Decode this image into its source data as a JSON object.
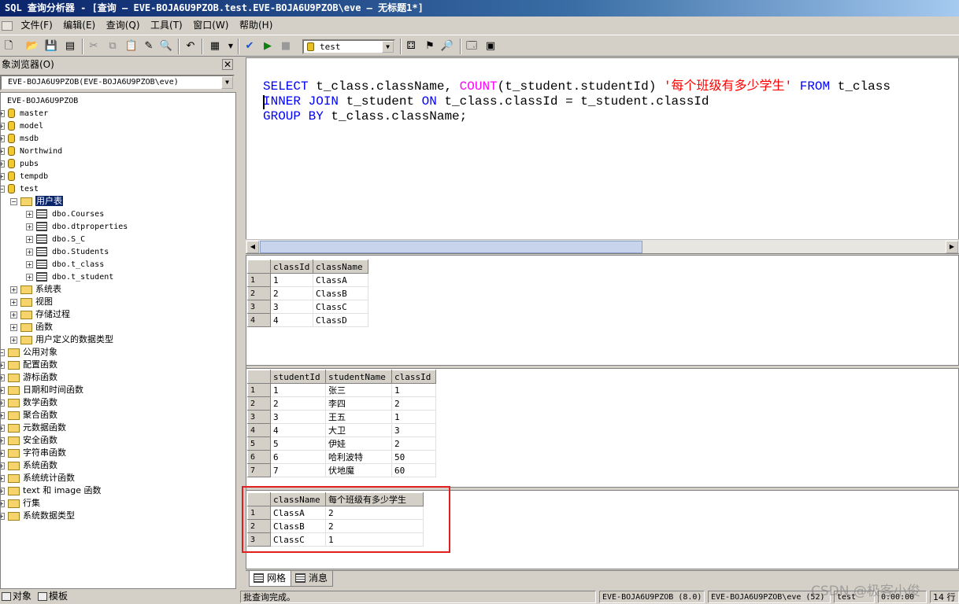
{
  "window": {
    "title": "SQL 查询分析器 - [查询 — EVE-BOJA6U9PZOB.test.EVE-BOJA6U9PZOB\\eve — 无标题1*]"
  },
  "menu": [
    "文件(F)",
    "编辑(E)",
    "查询(Q)",
    "工具(T)",
    "窗口(W)",
    "帮助(H)"
  ],
  "toolbar": {
    "database": "test"
  },
  "object_browser": {
    "title": "象浏览器(O)",
    "server": "EVE-BOJA6U9PZOB(EVE-BOJA6U9PZOB\\eve)",
    "root": "EVE-BOJA6U9PZOB",
    "databases": [
      "master",
      "model",
      "msdb",
      "Northwind",
      "pubs",
      "tempdb",
      "test"
    ],
    "user_tables_label": "用户表",
    "tables": [
      "dbo.Courses",
      "dbo.dtproperties",
      "dbo.S_C",
      "dbo.Students",
      "dbo.t_class",
      "dbo.t_student"
    ],
    "test_folders": [
      "系统表",
      "视图",
      "存储过程",
      "函数",
      "用户定义的数据类型"
    ],
    "common_label": "公用对象",
    "common_items": [
      "配置函数",
      "游标函数",
      "日期和时间函数",
      "数学函数",
      "聚合函数",
      "元数据函数",
      "安全函数",
      "字符串函数",
      "系统函数",
      "系统统计函数",
      "text 和 image 函数",
      "行集",
      "系统数据类型"
    ],
    "tabs": [
      "对象",
      "模板"
    ]
  },
  "editor": {
    "line1": [
      "SELECT",
      " t_class.className, ",
      "COUNT",
      "(t_student.studentId) ",
      "'每个班级有多少学生'",
      " FROM",
      " t_class"
    ],
    "line2": [
      "INNER JOIN",
      " t_student ",
      "ON",
      " t_class.classId = t_student.classId"
    ],
    "line3": [
      "GROUP BY",
      " t_class.className;"
    ]
  },
  "results": {
    "grid1": {
      "columns": [
        "classId",
        "className"
      ],
      "rows": [
        [
          "1",
          "ClassA"
        ],
        [
          "2",
          "ClassB"
        ],
        [
          "3",
          "ClassC"
        ],
        [
          "4",
          "ClassD"
        ]
      ]
    },
    "grid2": {
      "columns": [
        "studentId",
        "studentName",
        "classId"
      ],
      "rows": [
        [
          "1",
          "张三",
          "1"
        ],
        [
          "2",
          "李四",
          "2"
        ],
        [
          "3",
          "王五",
          "1"
        ],
        [
          "4",
          "大卫",
          "3"
        ],
        [
          "5",
          "伊娃",
          "2"
        ],
        [
          "6",
          "哈利波特",
          "50"
        ],
        [
          "7",
          "伏地魔",
          "60"
        ]
      ]
    },
    "grid3": {
      "columns": [
        "className",
        "每个班级有多少学生"
      ],
      "rows": [
        [
          "ClassA",
          "2"
        ],
        [
          "ClassB",
          "2"
        ],
        [
          "ClassC",
          "1"
        ]
      ]
    },
    "tabs": [
      "网格",
      "消息"
    ]
  },
  "status": {
    "message": "批查询完成。",
    "server": "EVE-BOJA6U9PZOB (8.0)",
    "user": "EVE-BOJA6U9PZOB\\eve (52)",
    "db": "test",
    "time": "0:00:00",
    "rows": "14 行"
  },
  "watermark": "CSDN @极客小俊"
}
